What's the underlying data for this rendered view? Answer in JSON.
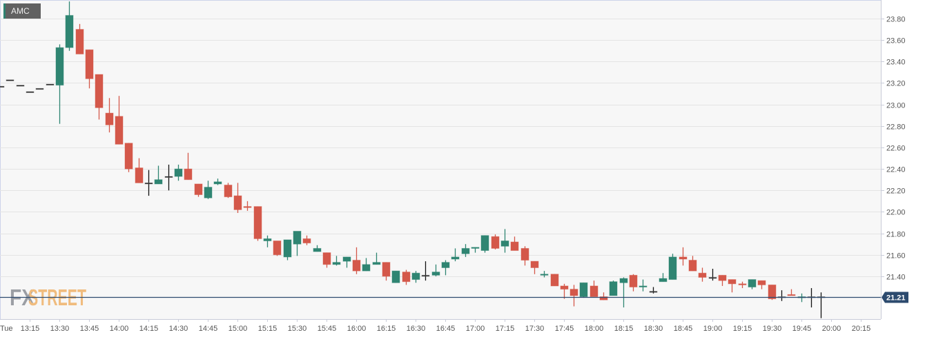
{
  "symbol": "AMC",
  "logo": {
    "part1": "FX",
    "part2": "STREET"
  },
  "colors": {
    "up": "#2f8572",
    "down": "#d4584a",
    "flat": "#111111",
    "price_line": "#2c4a6e",
    "grid": "#e4e4e4",
    "plot_bg": "#f7f7f7"
  },
  "chart_data": {
    "type": "candlestick",
    "title": "AMC",
    "interval_minutes": 5,
    "day_label": "Tue",
    "x_ticks": [
      "13:15",
      "13:30",
      "13:45",
      "14:00",
      "14:15",
      "14:30",
      "14:45",
      "15:00",
      "15:15",
      "15:30",
      "15:45",
      "16:00",
      "16:15",
      "16:30",
      "16:45",
      "17:00",
      "17:15",
      "17:30",
      "17:45",
      "18:00",
      "18:15",
      "18:30",
      "18:45",
      "19:00",
      "19:15",
      "19:30",
      "19:45",
      "20:00",
      "20:15"
    ],
    "y_ticks": [
      "23.80",
      "23.60",
      "23.40",
      "23.20",
      "23.00",
      "22.80",
      "22.60",
      "22.40",
      "22.20",
      "22.00",
      "21.80",
      "21.60",
      "21.40"
    ],
    "ylim": [
      21.0,
      23.97
    ],
    "grid": true,
    "last_price": "21.21",
    "columns": [
      "time",
      "open",
      "high",
      "low",
      "close"
    ],
    "candles": [
      [
        "13:00",
        23.17,
        23.17,
        23.17,
        23.17
      ],
      [
        "13:05",
        23.23,
        23.23,
        23.23,
        23.23
      ],
      [
        "13:10",
        23.18,
        23.18,
        23.18,
        23.18
      ],
      [
        "13:15",
        23.12,
        23.12,
        23.12,
        23.12
      ],
      [
        "13:20",
        23.15,
        23.15,
        23.15,
        23.15
      ],
      [
        "13:25",
        23.19,
        23.19,
        23.19,
        23.19
      ],
      [
        "13:30",
        23.18,
        23.56,
        22.82,
        23.53
      ],
      [
        "13:35",
        23.53,
        23.96,
        23.5,
        23.83
      ],
      [
        "13:40",
        23.7,
        23.75,
        23.47,
        23.47
      ],
      [
        "13:45",
        23.51,
        23.51,
        23.15,
        23.24
      ],
      [
        "13:50",
        23.28,
        23.28,
        22.86,
        22.97
      ],
      [
        "13:55",
        22.92,
        23.06,
        22.74,
        22.81
      ],
      [
        "14:00",
        22.89,
        23.08,
        22.63,
        22.63
      ],
      [
        "14:05",
        22.64,
        22.64,
        22.37,
        22.4
      ],
      [
        "14:10",
        22.41,
        22.5,
        22.27,
        22.27
      ],
      [
        "14:15",
        22.27,
        22.39,
        22.15,
        22.27
      ],
      [
        "14:20",
        22.26,
        22.43,
        22.26,
        22.3
      ],
      [
        "14:25",
        22.33,
        22.44,
        22.2,
        22.33
      ],
      [
        "14:30",
        22.33,
        22.44,
        22.29,
        22.4
      ],
      [
        "14:35",
        22.4,
        22.55,
        22.3,
        22.3
      ],
      [
        "14:40",
        22.26,
        22.26,
        22.14,
        22.16
      ],
      [
        "14:45",
        22.13,
        22.29,
        22.12,
        22.23
      ],
      [
        "14:50",
        22.26,
        22.31,
        22.25,
        22.28
      ],
      [
        "14:55",
        22.25,
        22.27,
        22.13,
        22.14
      ],
      [
        "15:00",
        22.15,
        22.27,
        21.99,
        22.02
      ],
      [
        "15:05",
        22.05,
        22.1,
        22.01,
        22.04
      ],
      [
        "15:10",
        22.05,
        22.05,
        21.73,
        21.75
      ],
      [
        "15:15",
        21.73,
        21.78,
        21.67,
        21.75
      ],
      [
        "15:20",
        21.73,
        21.73,
        21.59,
        21.6
      ],
      [
        "15:25",
        21.58,
        21.74,
        21.55,
        21.74
      ],
      [
        "15:30",
        21.7,
        21.82,
        21.59,
        21.82
      ],
      [
        "15:35",
        21.75,
        21.78,
        21.69,
        21.71
      ],
      [
        "15:40",
        21.63,
        21.69,
        21.63,
        21.66
      ],
      [
        "15:45",
        21.62,
        21.62,
        21.48,
        21.51
      ],
      [
        "15:50",
        21.51,
        21.59,
        21.5,
        21.53
      ],
      [
        "15:55",
        21.54,
        21.58,
        21.48,
        21.58
      ],
      [
        "16:00",
        21.55,
        21.67,
        21.42,
        21.45
      ],
      [
        "16:05",
        21.45,
        21.57,
        21.45,
        21.51
      ],
      [
        "16:10",
        21.51,
        21.62,
        21.51,
        21.53
      ],
      [
        "16:15",
        21.53,
        21.53,
        21.36,
        21.4
      ],
      [
        "16:20",
        21.34,
        21.45,
        21.34,
        21.45
      ],
      [
        "16:25",
        21.44,
        21.46,
        21.32,
        21.35
      ],
      [
        "16:30",
        21.37,
        21.45,
        21.34,
        21.43
      ],
      [
        "16:35",
        21.41,
        21.54,
        21.36,
        21.41
      ],
      [
        "16:40",
        21.41,
        21.51,
        21.4,
        21.44
      ],
      [
        "16:45",
        21.48,
        21.55,
        21.41,
        21.53
      ],
      [
        "16:50",
        21.56,
        21.66,
        21.54,
        21.58
      ],
      [
        "16:55",
        21.61,
        21.7,
        21.58,
        21.66
      ],
      [
        "17:00",
        21.66,
        21.67,
        21.62,
        21.67
      ],
      [
        "17:05",
        21.64,
        21.78,
        21.62,
        21.78
      ],
      [
        "17:10",
        21.77,
        21.79,
        21.65,
        21.66
      ],
      [
        "17:15",
        21.68,
        21.84,
        21.62,
        21.73
      ],
      [
        "17:20",
        21.72,
        21.77,
        21.64,
        21.64
      ],
      [
        "17:25",
        21.66,
        21.68,
        21.5,
        21.55
      ],
      [
        "17:30",
        21.54,
        21.54,
        21.42,
        21.48
      ],
      [
        "17:35",
        21.41,
        21.45,
        21.39,
        21.42
      ],
      [
        "17:40",
        21.42,
        21.42,
        21.31,
        21.31
      ],
      [
        "17:45",
        21.31,
        21.33,
        21.19,
        21.28
      ],
      [
        "17:50",
        21.28,
        21.32,
        21.12,
        21.22
      ],
      [
        "17:55",
        21.21,
        21.34,
        21.2,
        21.34
      ],
      [
        "18:00",
        21.31,
        21.36,
        21.21,
        21.21
      ],
      [
        "18:05",
        21.21,
        21.25,
        21.18,
        21.18
      ],
      [
        "18:10",
        21.22,
        21.36,
        21.22,
        21.35
      ],
      [
        "18:15",
        21.34,
        21.39,
        21.11,
        21.38
      ],
      [
        "18:20",
        21.41,
        21.42,
        21.26,
        21.3
      ],
      [
        "18:25",
        21.3,
        21.37,
        21.26,
        21.31
      ],
      [
        "18:30",
        21.26,
        21.3,
        21.24,
        21.26
      ],
      [
        "18:35",
        21.35,
        21.43,
        21.35,
        21.38
      ],
      [
        "18:40",
        21.37,
        21.61,
        21.37,
        21.58
      ],
      [
        "18:45",
        21.58,
        21.67,
        21.5,
        21.56
      ],
      [
        "18:50",
        21.55,
        21.59,
        21.45,
        21.45
      ],
      [
        "18:55",
        21.43,
        21.48,
        21.35,
        21.39
      ],
      [
        "19:00",
        21.39,
        21.47,
        21.36,
        21.39
      ],
      [
        "19:05",
        21.41,
        21.41,
        21.31,
        21.36
      ],
      [
        "19:10",
        21.37,
        21.37,
        21.25,
        21.33
      ],
      [
        "19:15",
        21.33,
        21.35,
        21.29,
        21.32
      ],
      [
        "19:20",
        21.3,
        21.37,
        21.28,
        21.37
      ],
      [
        "19:25",
        21.36,
        21.36,
        21.28,
        21.32
      ],
      [
        "19:30",
        21.32,
        21.32,
        21.18,
        21.19
      ],
      [
        "19:35",
        21.21,
        21.27,
        21.17,
        21.21
      ],
      [
        "19:40",
        21.23,
        21.28,
        21.22,
        21.22
      ],
      [
        "19:45",
        21.2,
        21.24,
        21.16,
        21.21
      ],
      [
        "19:50",
        21.21,
        21.29,
        21.11,
        21.21
      ],
      [
        "19:55",
        21.21,
        21.25,
        21.01,
        21.21
      ]
    ]
  }
}
